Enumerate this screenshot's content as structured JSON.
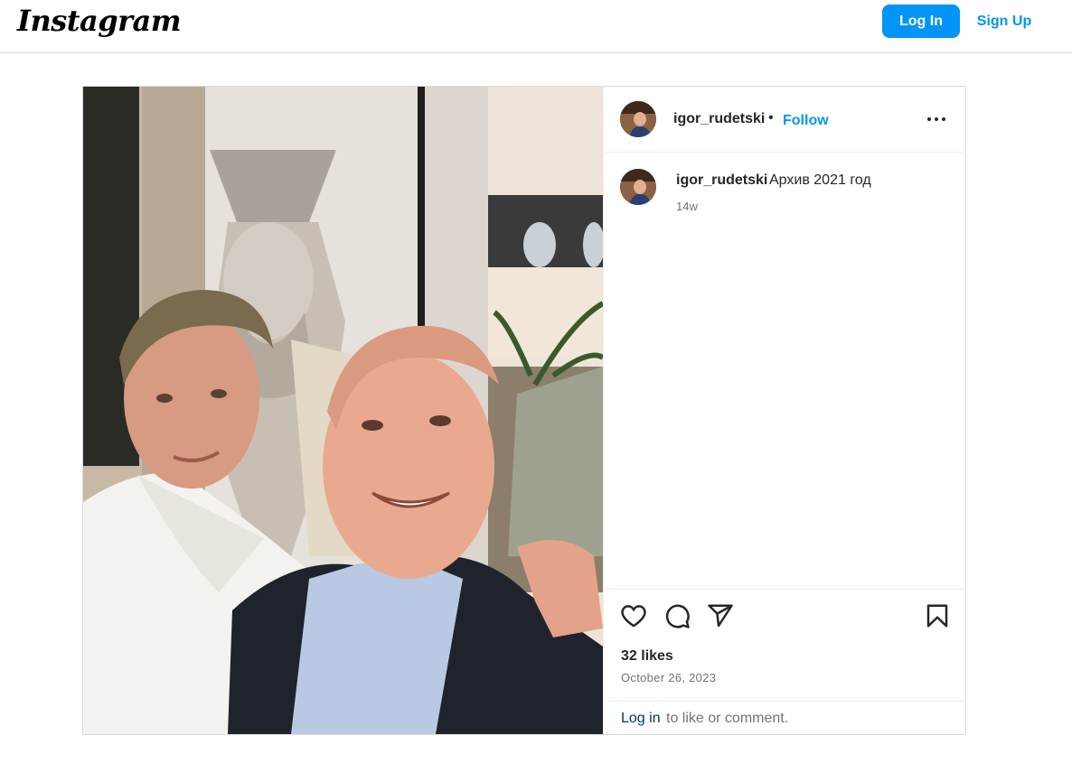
{
  "header": {
    "logo": "Instagram",
    "login_label": "Log In",
    "signup_label": "Sign Up"
  },
  "post": {
    "username": "igor_rudetski",
    "separator": "•",
    "follow_label": "Follow",
    "more_icon": "more-horizontal-icon",
    "caption": {
      "username": "igor_rudetski",
      "text": "Архив 2021 год",
      "time_ago": "14w"
    },
    "actions": {
      "like_icon": "heart-icon",
      "comment_icon": "comment-icon",
      "share_icon": "send-icon",
      "save_icon": "bookmark-icon"
    },
    "likes": "32 likes",
    "date": "October 26, 2023",
    "login_prompt": {
      "link": "Log in",
      "text": "to like or comment."
    }
  },
  "colors": {
    "accent": "#0095f6",
    "border": "#dbdbdb",
    "muted": "#737373",
    "link_dark": "#00376b"
  }
}
